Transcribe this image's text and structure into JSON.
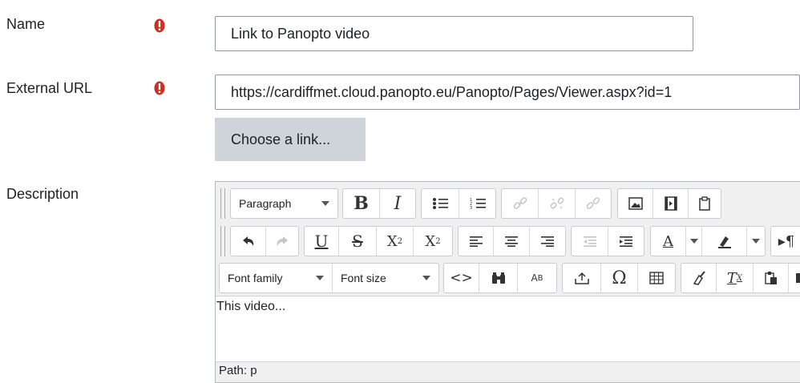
{
  "form": {
    "name": {
      "label": "Name",
      "value": "Link to Panopto video",
      "required_icon": "exclamation-circle-icon"
    },
    "external_url": {
      "label": "External URL",
      "value": "https://cardiffmet.cloud.panopto.eu/Panopto/Pages/Viewer.aspx?id=1",
      "required_icon": "exclamation-circle-icon",
      "choose_link_label": "Choose a link..."
    },
    "description": {
      "label": "Description"
    }
  },
  "editor": {
    "paragraph_select": "Paragraph",
    "font_family_select": "Font family",
    "font_size_select": "Font size",
    "content": "This video...",
    "path": "Path: p"
  },
  "colors": {
    "required": "#ca3120",
    "button_bg": "#ced4da",
    "toolbar_bg": "#f0f0f0"
  }
}
